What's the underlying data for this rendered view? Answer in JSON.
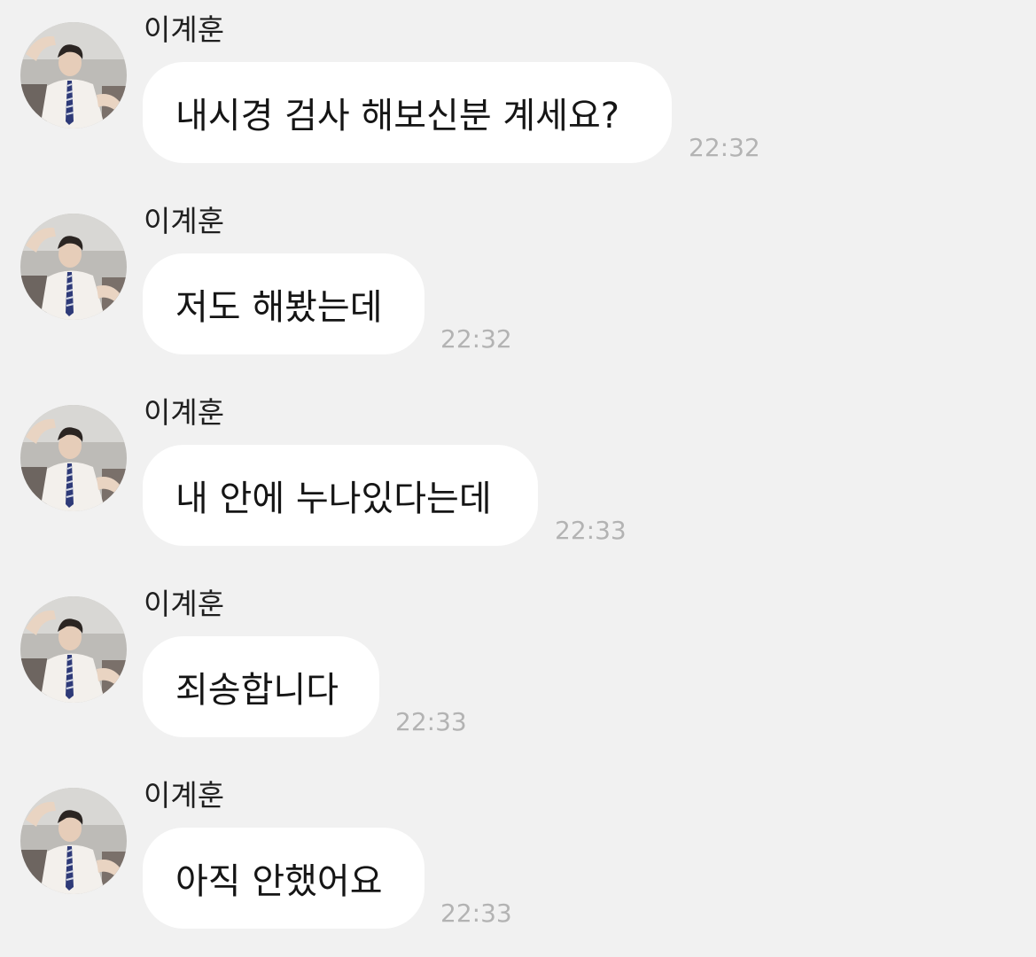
{
  "messages": [
    {
      "sender": "이계훈",
      "text": "내시경 검사 해보신분 계세요?",
      "time": "22:32"
    },
    {
      "sender": "이계훈",
      "text": "저도 해봤는데",
      "time": "22:32"
    },
    {
      "sender": "이계훈",
      "text": "내 안에 누나있다는데",
      "time": "22:33"
    },
    {
      "sender": "이계훈",
      "text": "죄송합니다",
      "time": "22:33"
    },
    {
      "sender": "이계훈",
      "text": "아직 안했어요",
      "time": "22:33"
    }
  ],
  "colors": {
    "background": "#f1f1f1",
    "bubble": "#ffffff",
    "text": "#151515",
    "time": "#b3b3b3"
  },
  "icons": {
    "avatar": "profile-photo-avatar"
  }
}
